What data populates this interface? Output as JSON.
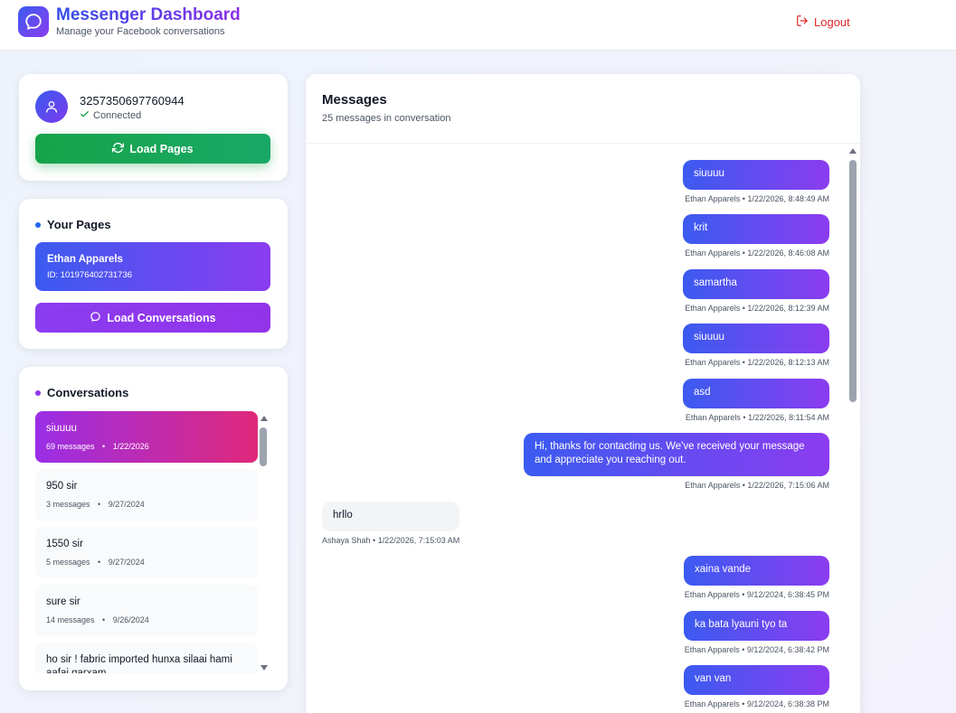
{
  "header": {
    "title": "Messenger Dashboard",
    "subtitle": "Manage your Facebook conversations",
    "logout_label": "Logout",
    "logo_icon": "chat-bubble-icon",
    "logout_icon": "logout-icon"
  },
  "user": {
    "id": "3257350697760944",
    "status": "Connected",
    "avatar_icon": "user-icon",
    "status_icon": "check-icon"
  },
  "load_pages_button": {
    "label": "Load Pages",
    "icon": "refresh-icon"
  },
  "pages": {
    "title": "Your Pages",
    "items": [
      {
        "name": "Ethan Apparels",
        "id_text": "ID: 101976402731736"
      }
    ],
    "load_conversations_label": "Load Conversations",
    "load_conversations_icon": "chat-bubble-icon"
  },
  "conversations": {
    "title": "Conversations",
    "items": [
      {
        "name": "siuuuu",
        "count": "69 messages",
        "sep": "•",
        "date": "1/22/2026",
        "active": true
      },
      {
        "name": "950 sir",
        "count": "3 messages",
        "sep": "•",
        "date": "9/27/2024",
        "active": false
      },
      {
        "name": "1550 sir",
        "count": "5 messages",
        "sep": "•",
        "date": "9/27/2024",
        "active": false
      },
      {
        "name": "sure sir",
        "count": "14 messages",
        "sep": "•",
        "date": "9/26/2024",
        "active": false
      },
      {
        "name": "ho sir ! fabric imported hunxa silaai hami aafai garxam",
        "count": "",
        "sep": "",
        "date": "",
        "active": false
      }
    ]
  },
  "messages_panel": {
    "title": "Messages",
    "count_text": "25 messages in conversation",
    "messages": [
      {
        "text": "siuuuu",
        "meta": "Ethan Apparels • 1/22/2026, 8:48:49 AM",
        "direction": "out"
      },
      {
        "text": "krit",
        "meta": "Ethan Apparels • 1/22/2026, 8:46:08 AM",
        "direction": "out"
      },
      {
        "text": "samartha",
        "meta": "Ethan Apparels • 1/22/2026, 8:12:39 AM",
        "direction": "out"
      },
      {
        "text": "siuuuu",
        "meta": "Ethan Apparels • 1/22/2026, 8:12:13 AM",
        "direction": "out"
      },
      {
        "text": "asd",
        "meta": "Ethan Apparels • 1/22/2026, 8:11:54 AM",
        "direction": "out"
      },
      {
        "text": "Hi, thanks for contacting us. We've received your message and appreciate you reaching out.",
        "meta": "Ethan Apparels • 1/22/2026, 7:15:06 AM",
        "direction": "out"
      },
      {
        "text": "hrllo",
        "meta": "Ashaya Shah • 1/22/2026, 7:15:03 AM",
        "direction": "in"
      },
      {
        "text": "xaina vande",
        "meta": "Ethan Apparels • 9/12/2024, 6:38:45 PM",
        "direction": "out"
      },
      {
        "text": "ka bata lyauni tyo ta",
        "meta": "Ethan Apparels • 9/12/2024, 6:38:42 PM",
        "direction": "out"
      },
      {
        "text": "van van",
        "meta": "Ethan Apparels • 9/12/2024, 6:38:38 PM",
        "direction": "out"
      }
    ]
  },
  "colors": {
    "brand_blue": "#3b5bf0",
    "brand_purple": "#8b3cf0",
    "success_green": "#16a34a",
    "logout_red": "#dc2626",
    "active_conv_pink": "#e0287a"
  }
}
